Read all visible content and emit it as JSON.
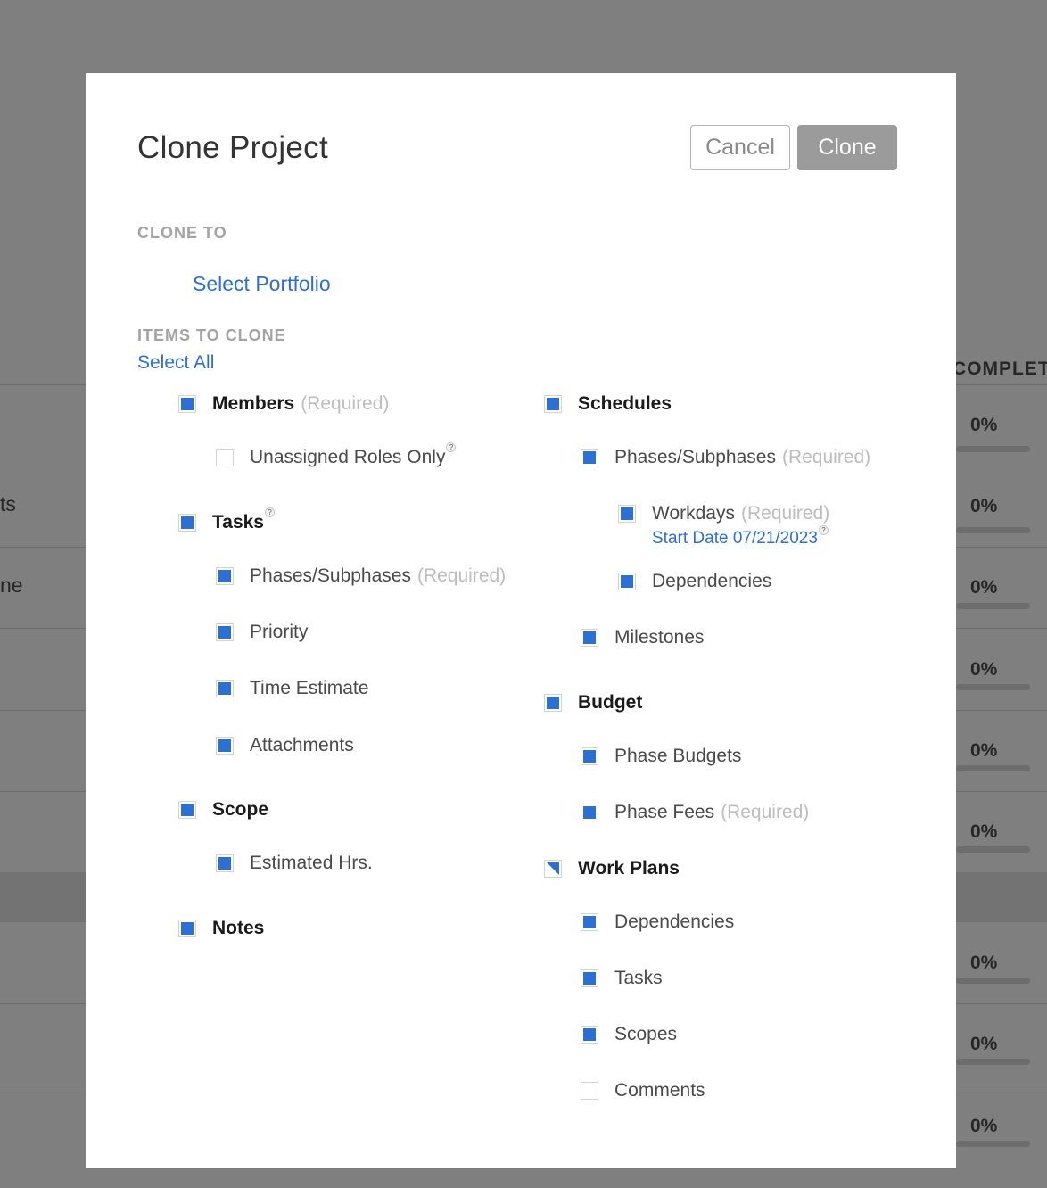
{
  "background": {
    "column_header": "COMPLETED",
    "left_fragments": [
      "ts",
      "ne"
    ],
    "row_percents": [
      "0%",
      "0%",
      "0%",
      "0%",
      "0%",
      "0%",
      "0%",
      "0%",
      "0%"
    ]
  },
  "modal": {
    "title": "Clone Project",
    "cancel_label": "Cancel",
    "clone_label": "Clone",
    "clone_to_label": "CLONE TO",
    "select_portfolio_label": "Select Portfolio",
    "items_to_clone_label": "ITEMS TO CLONE",
    "select_all_label": "Select All",
    "required_text": "(Required)",
    "help_glyph": "?"
  },
  "left_column": {
    "members": "Members",
    "unassigned_roles_only": "Unassigned Roles Only",
    "tasks": "Tasks",
    "tasks_phases": "Phases/Subphases",
    "priority": "Priority",
    "time_estimate": "Time Estimate",
    "attachments": "Attachments",
    "scope": "Scope",
    "estimated_hrs": "Estimated Hrs.",
    "notes": "Notes"
  },
  "right_column": {
    "schedules": "Schedules",
    "schedules_phases": "Phases/Subphases",
    "workdays": "Workdays",
    "start_date": "Start Date 07/21/2023",
    "dependencies": "Dependencies",
    "milestones": "Milestones",
    "budget": "Budget",
    "phase_budgets": "Phase Budgets",
    "phase_fees": "Phase Fees",
    "work_plans": "Work Plans",
    "wp_dependencies": "Dependencies",
    "wp_tasks": "Tasks",
    "wp_scopes": "Scopes",
    "wp_comments": "Comments"
  },
  "colors": {
    "accent": "#2d6fd2",
    "link": "#2f6fd0",
    "overlay": "#808080"
  }
}
